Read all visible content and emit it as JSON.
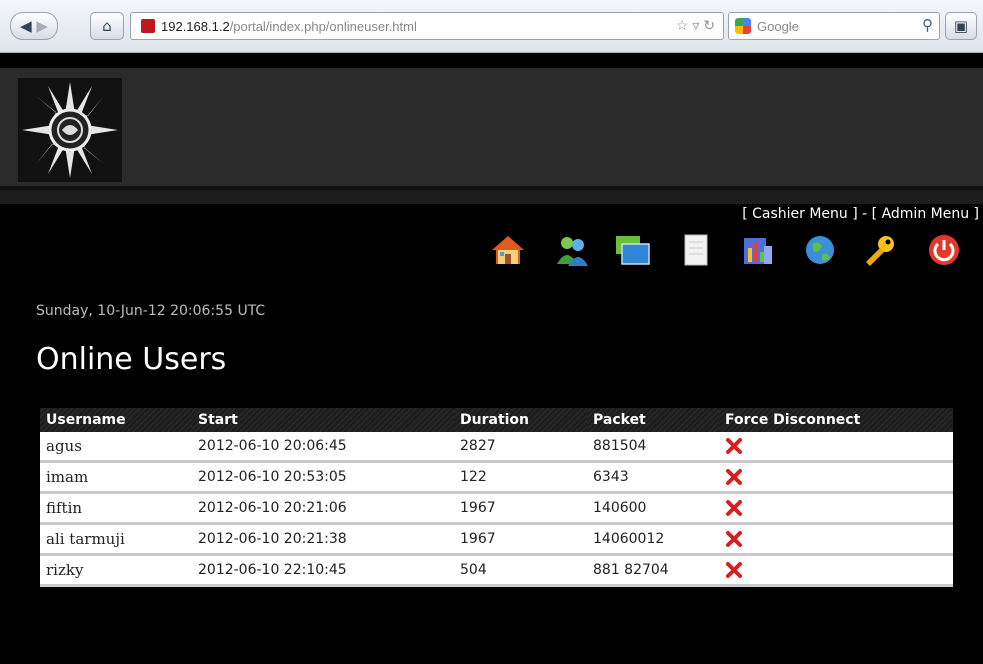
{
  "browser": {
    "url_host": "192.168.1.2",
    "url_path": "/portal/index.php/onlineuser.html",
    "search_placeholder": "Google"
  },
  "top_menu": {
    "cashier": "[ Cashier Menu ]",
    "separator": " - ",
    "admin": "[ Admin Menu ]"
  },
  "toolbar_icons": [
    "home-icon",
    "users-icon",
    "monitors-icon",
    "document-icon",
    "report-icon",
    "globe-icon",
    "key-icon",
    "power-icon"
  ],
  "date_line": "Sunday, 10-Jun-12 20:06:55 UTC",
  "page_title": "Online Users",
  "table": {
    "headers": [
      "Username",
      "Start",
      "Duration",
      "Packet",
      "Force Disconnect"
    ],
    "rows": [
      {
        "username": "agus",
        "start": "2012-06-10 20:06:45",
        "duration": "2827",
        "packet": "881504"
      },
      {
        "username": "imam",
        "start": "2012-06-10 20:53:05",
        "duration": "122",
        "packet": "6343"
      },
      {
        "username": "fiftin",
        "start": "2012-06-10 20:21:06",
        "duration": "1967",
        "packet": "140600"
      },
      {
        "username": "ali tarmuji",
        "start": "2012-06-10 20:21:38",
        "duration": "1967",
        "packet": "14060012"
      },
      {
        "username": "rizky",
        "start": "2012-06-10 22:10:45",
        "duration": "504",
        "packet": "881 82704"
      }
    ]
  },
  "colors": {
    "disconnect": "#d62020",
    "header_bg": "#2a2a2a"
  }
}
